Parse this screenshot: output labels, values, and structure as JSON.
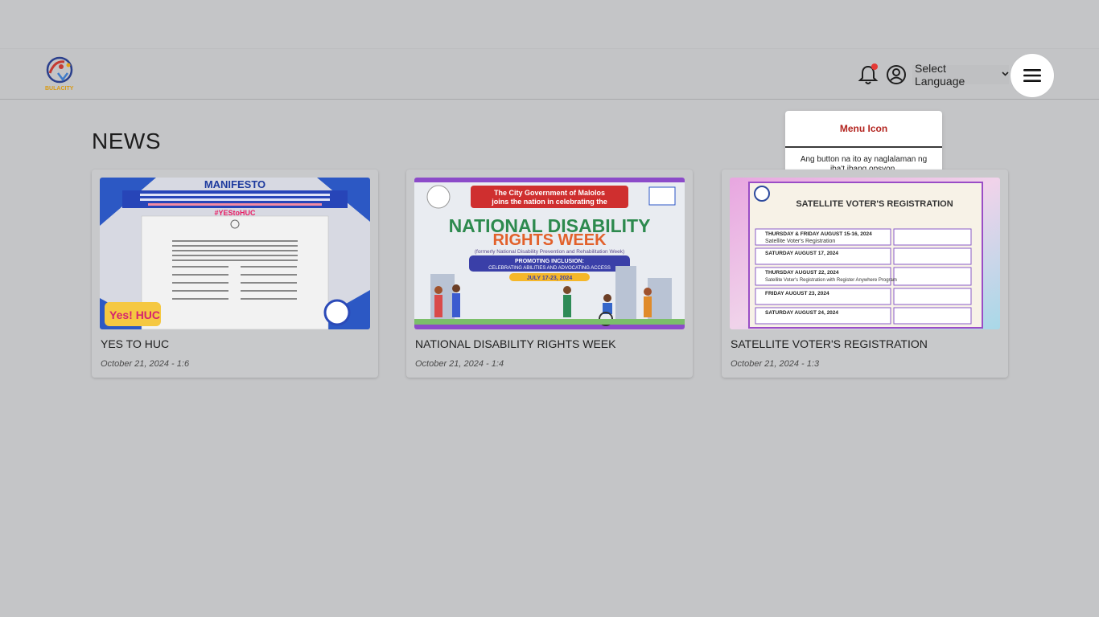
{
  "header": {
    "logo_label": "BULACITY",
    "language_select": "Select Language"
  },
  "tooltip": {
    "title": "Menu Icon",
    "body": "Ang button na ito ay naglalaman ng iba't ibang opsyon."
  },
  "news": {
    "heading": "NEWS",
    "items": [
      {
        "title": "YES TO HUC",
        "date": "October 21, 2024 - 1:6",
        "image_text": [
          "MANIFESTO",
          "#YEStoHUC",
          "Yes! HUC"
        ]
      },
      {
        "title": "NATIONAL DISABILITY RIGHTS WEEK",
        "date": "October 21, 2024 - 1:4",
        "image_text": [
          "The City Government of Malolos",
          "joins the nation in celebrating the",
          "NATIONAL DISABILITY",
          "RIGHTS WEEK",
          "(formerly National Disability Prevention and Rehabilitation Week)",
          "PROMOTING INCLUSION:",
          "CELEBRATING ABILITIES AND ADVOCATING ACCESS",
          "JULY 17-23, 2024"
        ]
      },
      {
        "title": "SATELLITE VOTER'S REGISTRATION",
        "date": "October 21, 2024 - 1:3",
        "image_text": [
          "SATELLITE VOTER'S REGISTRATION",
          "THURSDAY & FRIDAY AUGUST 15-16, 2024",
          "Satellite Voter's Registration",
          "SATURDAY AUGUST 17, 2024",
          "THURSDAY AUGUST 22, 2024",
          "Satellite Voter's Registration with Register Anywhere Program",
          "FRIDAY AUGUST 23, 2024",
          "SATURDAY AUGUST 24, 2024"
        ]
      }
    ]
  },
  "colors": {
    "overlay_bg": "#c4c5c7",
    "tooltip_title": "#b3241f",
    "notification_dot": "#e53935"
  },
  "icons": [
    "bell-icon",
    "user-circle-icon",
    "chevron-down-icon",
    "hamburger-menu-icon"
  ]
}
